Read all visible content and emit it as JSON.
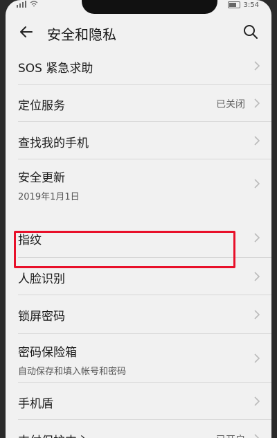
{
  "status_bar": {
    "time": "3:54"
  },
  "header": {
    "title": "安全和隐私",
    "back_icon": "back-arrow-icon",
    "search_icon": "search-icon"
  },
  "items": [
    {
      "label": "SOS 紧急求助"
    },
    {
      "label": "定位服务",
      "value": "已关闭"
    },
    {
      "label": "查找我的手机"
    },
    {
      "label": "安全更新",
      "sub": "2019年1月1日"
    },
    {
      "label": "指纹"
    },
    {
      "label": "人脸识别"
    },
    {
      "label": "锁屏密码"
    },
    {
      "label": "密码保险箱",
      "sub": "自动保存和填入帐号和密码"
    },
    {
      "label": "手机盾"
    },
    {
      "label": "支付保护中心",
      "value": "已开启"
    }
  ],
  "colors": {
    "highlight": "#e8102a",
    "background": "#f1f1f1"
  }
}
